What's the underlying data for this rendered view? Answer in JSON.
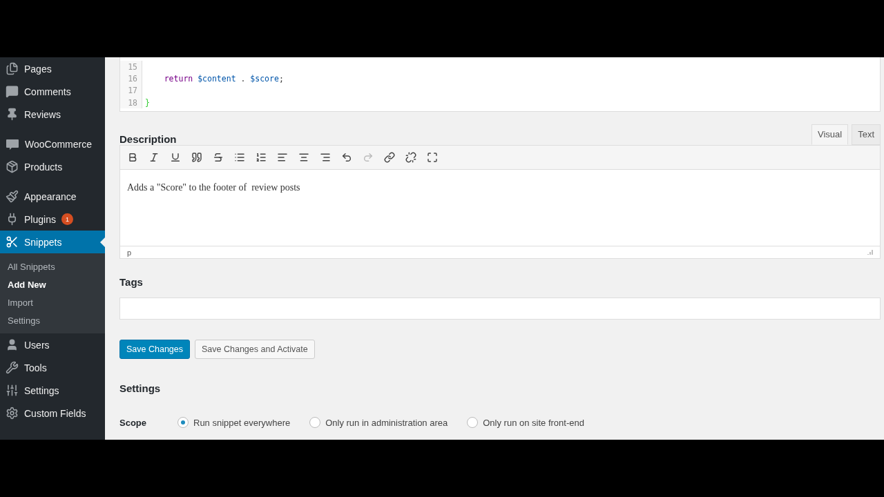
{
  "sidebar": {
    "groups": [
      {
        "items": [
          {
            "label": "Pages",
            "selected": false
          },
          {
            "label": "Comments",
            "selected": false
          },
          {
            "label": "Reviews",
            "selected": false
          }
        ]
      },
      {
        "items": [
          {
            "label": "WooCommerce",
            "selected": false
          },
          {
            "label": "Products",
            "selected": false
          }
        ]
      },
      {
        "items": [
          {
            "label": "Appearance",
            "selected": false
          },
          {
            "label": "Plugins",
            "selected": false,
            "badge": "1"
          },
          {
            "label": "Snippets",
            "selected": true,
            "children": [
              {
                "label": "All Snippets",
                "selected": false
              },
              {
                "label": "Add New",
                "selected": true
              },
              {
                "label": "Import",
                "selected": false
              },
              {
                "label": "Settings",
                "selected": false
              }
            ]
          },
          {
            "label": "Users",
            "selected": false
          },
          {
            "label": "Tools",
            "selected": false
          },
          {
            "label": "Settings",
            "selected": false
          },
          {
            "label": "Custom Fields",
            "selected": false
          }
        ]
      }
    ]
  },
  "code_editor": {
    "lines": [
      {
        "number": "15"
      },
      {
        "number": "16",
        "tokens": [
          {
            "text": "    return",
            "kind": "keyword"
          },
          {
            "text": " $content",
            "kind": "variable"
          },
          {
            "text": " . ",
            "kind": "plain"
          },
          {
            "text": "$score",
            "kind": "variable"
          },
          {
            "text": ";",
            "kind": "plain"
          }
        ]
      },
      {
        "number": "17"
      },
      {
        "number": "18",
        "tokens": [
          {
            "text": "}",
            "kind": "bracket"
          }
        ]
      }
    ]
  },
  "description": {
    "heading": "Description",
    "tabs": [
      {
        "label": "Visual",
        "selected": true
      },
      {
        "label": "Text",
        "selected": false
      }
    ],
    "toolbar": [
      {
        "kind": "bold",
        "disabled": false
      },
      {
        "kind": "italic",
        "disabled": false
      },
      {
        "kind": "underline",
        "disabled": false
      },
      {
        "kind": "quote",
        "disabled": false
      },
      {
        "kind": "strike",
        "disabled": false
      },
      {
        "kind": "bullets",
        "disabled": false
      },
      {
        "kind": "numbers",
        "disabled": false
      },
      {
        "kind": "align-left",
        "disabled": false
      },
      {
        "kind": "align-center",
        "disabled": false
      },
      {
        "kind": "align-right",
        "disabled": false
      },
      {
        "kind": "undo",
        "disabled": false
      },
      {
        "kind": "redo",
        "disabled": true
      },
      {
        "kind": "link",
        "disabled": false
      },
      {
        "kind": "unlink",
        "disabled": false
      },
      {
        "kind": "fullscreen",
        "disabled": false
      }
    ],
    "content": "Adds a \"Score\" to the footer of  review posts",
    "path": "p"
  },
  "tags": {
    "heading": "Tags"
  },
  "buttons": [
    {
      "label": "Save Changes",
      "kind": "primary"
    },
    {
      "label": "Save Changes and Activate",
      "kind": "secondary"
    }
  ],
  "settings": {
    "heading": "Settings",
    "scope": {
      "label": "Scope",
      "options": [
        {
          "label": "Run snippet everywhere",
          "selected": true
        },
        {
          "label": "Only run in administration area",
          "selected": false
        },
        {
          "label": "Only run on site front-end",
          "selected": false
        }
      ]
    }
  }
}
